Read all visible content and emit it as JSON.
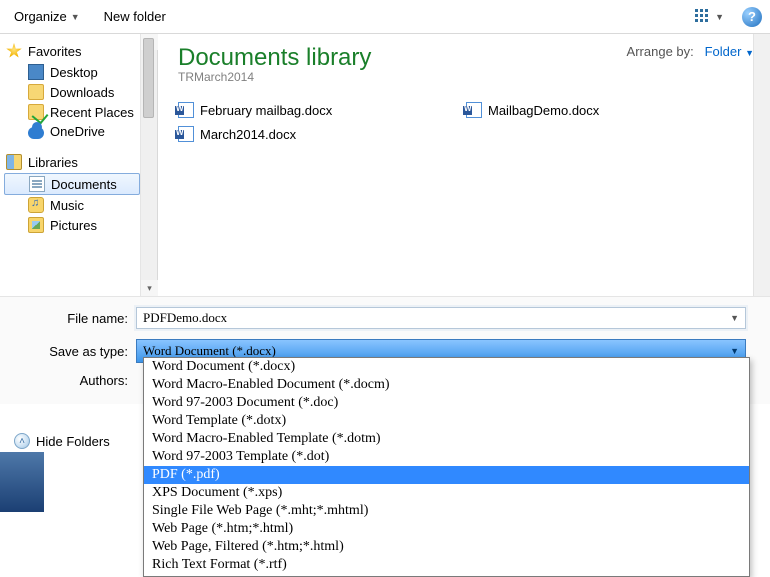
{
  "toolbar": {
    "organize_label": "Organize",
    "newfolder_label": "New folder"
  },
  "sidebar": {
    "favorites_label": "Favorites",
    "items_fav": [
      {
        "label": "Desktop"
      },
      {
        "label": "Downloads"
      },
      {
        "label": "Recent Places"
      },
      {
        "label": "OneDrive"
      }
    ],
    "libraries_label": "Libraries",
    "items_lib": [
      {
        "label": "Documents"
      },
      {
        "label": "Music"
      },
      {
        "label": "Pictures"
      }
    ]
  },
  "library": {
    "title": "Documents library",
    "subtitle": "TRMarch2014",
    "arrange_label": "Arrange by:",
    "arrange_value": "Folder",
    "files": [
      "February mailbag.docx",
      "MailbagDemo.docx",
      "March2014.docx"
    ]
  },
  "form": {
    "filename_label": "File name:",
    "filename_value": "PDFDemo.docx",
    "saveastype_label": "Save as type:",
    "saveastype_value": "Word Document (*.docx)",
    "authors_label": "Authors:"
  },
  "type_dropdown": {
    "options": [
      "Word Document (*.docx)",
      "Word Macro-Enabled Document (*.docm)",
      "Word 97-2003 Document (*.doc)",
      "Word Template (*.dotx)",
      "Word Macro-Enabled Template (*.dotm)",
      "Word 97-2003 Template (*.dot)",
      "PDF (*.pdf)",
      "XPS Document (*.xps)",
      "Single File Web Page (*.mht;*.mhtml)",
      "Web Page (*.htm;*.html)",
      "Web Page, Filtered (*.htm;*.html)",
      "Rich Text Format (*.rtf)"
    ],
    "highlight_index": 6
  },
  "footer": {
    "hidefolders_label": "Hide Folders"
  }
}
